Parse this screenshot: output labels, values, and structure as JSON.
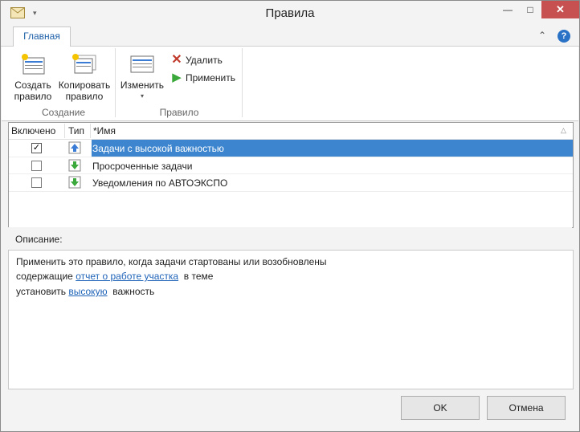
{
  "window": {
    "title": "Правила"
  },
  "ribbon": {
    "tab_home": "Главная",
    "group_create": {
      "label": "Создание",
      "create_button": [
        "Создать",
        "правило"
      ],
      "copy_button": [
        "Копировать",
        "правило"
      ]
    },
    "group_rule": {
      "label": "Правило",
      "change_button": "Изменить",
      "delete_button": "Удалить",
      "apply_button": "Применить"
    }
  },
  "rules_table": {
    "columns": [
      "Включено",
      "Тип",
      "*Имя"
    ],
    "rows": [
      {
        "enabled": true,
        "name": "Задачи с высокой важностью",
        "selected": true
      },
      {
        "enabled": false,
        "name": "Просроченные задачи",
        "selected": false
      },
      {
        "enabled": false,
        "name": "Уведомления по АВТОЭКСПО",
        "selected": false
      }
    ]
  },
  "description": {
    "label": "Описание:",
    "line1": "Применить это правило, когда задачи стартованы или возобновлены",
    "line2_prefix": "содержащие",
    "line2_link": "отчет о работе участка",
    "line2_suffix": "в теме",
    "line3_prefix": "установить",
    "line3_link": "высокую",
    "line3_suffix": "важность"
  },
  "buttons": {
    "ok": "OK",
    "cancel": "Отмена"
  },
  "colors": {
    "selection": "#3d86cf",
    "link": "#1e63b8",
    "close": "#c75050"
  }
}
